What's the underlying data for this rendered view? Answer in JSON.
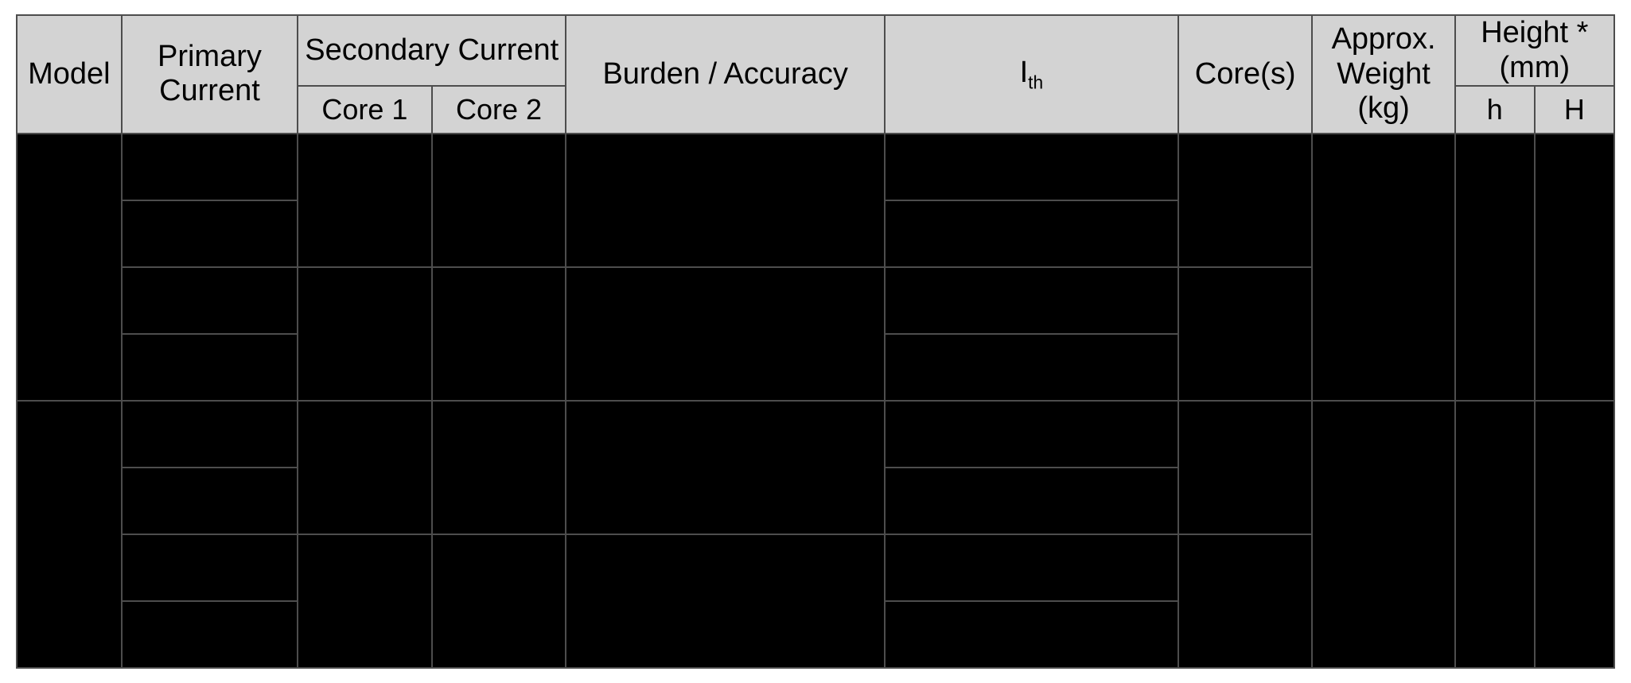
{
  "headers": {
    "model": "Model",
    "primary_current": "Primary Current",
    "secondary_current": "Secondary Current",
    "core1": "Core 1",
    "core2": "Core 2",
    "burden_accuracy": "Burden / Accuracy",
    "ith_html": "I<sub>th</sub>",
    "cores": "Core(s)",
    "weight": "Approx. Weight (kg)",
    "height_group": "Height * (mm)",
    "height_h": "h",
    "height_H": "H"
  },
  "chart_data": {
    "type": "table",
    "title": "",
    "columns": [
      "Model",
      "Primary Current",
      "Secondary Current Core 1",
      "Secondary Current Core 2",
      "Burden / Accuracy",
      "I_th",
      "Core(s)",
      "Approx. Weight (kg)",
      "Height h (mm)",
      "Height H (mm)"
    ],
    "rows": [
      [
        null,
        null,
        null,
        null,
        null,
        null,
        null,
        null,
        null,
        null
      ],
      [
        null,
        null,
        null,
        null,
        null,
        null,
        null,
        null,
        null,
        null
      ],
      [
        null,
        null,
        null,
        null,
        null,
        null,
        null,
        null,
        null,
        null
      ],
      [
        null,
        null,
        null,
        null,
        null,
        null,
        null,
        null,
        null,
        null
      ],
      [
        null,
        null,
        null,
        null,
        null,
        null,
        null,
        null,
        null,
        null
      ],
      [
        null,
        null,
        null,
        null,
        null,
        null,
        null,
        null,
        null,
        null
      ],
      [
        null,
        null,
        null,
        null,
        null,
        null,
        null,
        null,
        null,
        null
      ],
      [
        null,
        null,
        null,
        null,
        null,
        null,
        null,
        null,
        null,
        null
      ]
    ],
    "note": "All body cells are blacked out / redacted in the source image; no values are legible."
  }
}
